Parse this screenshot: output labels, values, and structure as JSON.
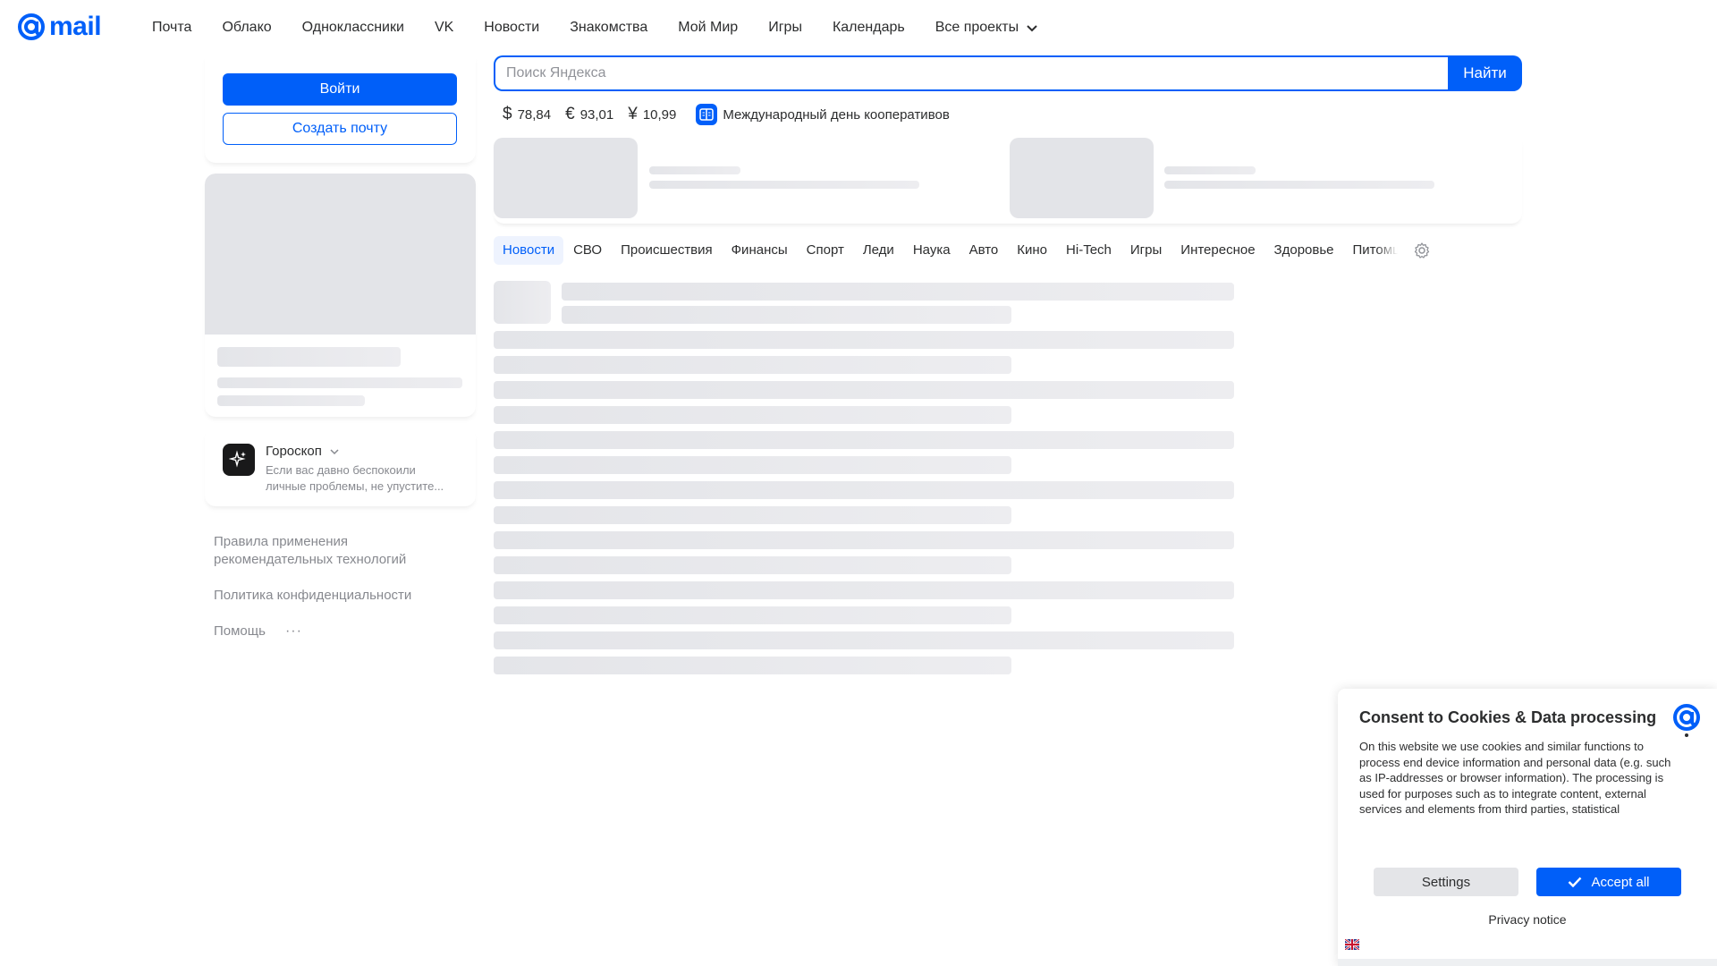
{
  "logo": {
    "text": "mail"
  },
  "nav": [
    "Почта",
    "Облако",
    "Одноклассники",
    "VK",
    "Новости",
    "Знакомства",
    "Мой Мир",
    "Игры",
    "Календарь"
  ],
  "nav_all": "Все проекты",
  "login": {
    "signin": "Войти",
    "create": "Создать почту"
  },
  "horoscope": {
    "title": "Гороскоп",
    "text": "Если вас давно беспокоили личные проблемы, не упустите..."
  },
  "left_links": {
    "rules": "Правила применения рекомендательных технологий",
    "privacy": "Политика конфиденциальности",
    "help": "Помощь",
    "more": "···"
  },
  "search": {
    "placeholder": "Поиск Яндекса",
    "button": "Найти"
  },
  "rates": [
    {
      "symbol": "$",
      "value": "78,84"
    },
    {
      "symbol": "€",
      "value": "93,01"
    },
    {
      "symbol": "¥",
      "value": "10,99"
    }
  ],
  "holiday": "Международный день кооперативов",
  "tabs": [
    "Новости",
    "СВО",
    "Происшествия",
    "Финансы",
    "Спорт",
    "Леди",
    "Наука",
    "Авто",
    "Кино",
    "Hi-Tech",
    "Игры",
    "Интересное",
    "Здоровье",
    "Питомцы"
  ],
  "active_tab": "Новости",
  "consent": {
    "title": "Consent to Cookies & Data processing",
    "text": "On this website we use cookies and similar functions to process end device information and personal data (e.g. such as IP-addresses or browser information). The processing is used for purposes such as to integrate content, external services and elements from third parties, statistical analysis/measurement, personalized advertising and the integration of social media. Depending on the function, data may be passed on to third parties.",
    "settings": "Settings",
    "accept": "Accept all",
    "privacy": "Privacy notice"
  },
  "colors": {
    "brand": "#005ff9",
    "skeleton": "#e4e5e9"
  }
}
